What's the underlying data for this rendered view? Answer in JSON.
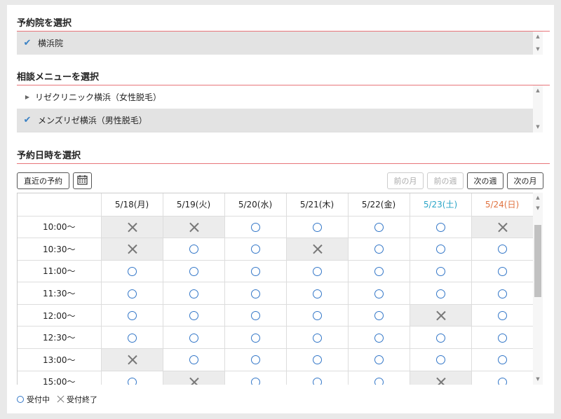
{
  "sections": {
    "clinic_title": "予約院を選択",
    "menu_title": "相談メニューを選択",
    "datetime_title": "予約日時を選択"
  },
  "clinic_list": {
    "items": [
      {
        "label": "横浜院",
        "selected": true
      }
    ]
  },
  "menu_list": {
    "items": [
      {
        "label": "リゼクリニック横浜（女性脱毛）",
        "selected": false
      },
      {
        "label": "メンズリゼ横浜（男性脱毛）",
        "selected": true
      }
    ]
  },
  "toolbar": {
    "recent_label": "直近の予約",
    "calendar_icon": "calendar-icon",
    "prev_month_label": "前の月",
    "prev_week_label": "前の週",
    "next_week_label": "次の週",
    "next_month_label": "次の月"
  },
  "schedule": {
    "days": [
      {
        "label": "5/18(月)",
        "kind": "weekday"
      },
      {
        "label": "5/19(火)",
        "kind": "weekday"
      },
      {
        "label": "5/20(水)",
        "kind": "weekday"
      },
      {
        "label": "5/21(木)",
        "kind": "weekday"
      },
      {
        "label": "5/22(金)",
        "kind": "weekday"
      },
      {
        "label": "5/23(土)",
        "kind": "saturday"
      },
      {
        "label": "5/24(日)",
        "kind": "sunday"
      }
    ],
    "rows": [
      {
        "time": "10:00〜",
        "slots": [
          "x",
          "x",
          "o",
          "o",
          "o",
          "o",
          "x"
        ]
      },
      {
        "time": "10:30〜",
        "slots": [
          "x",
          "o",
          "o",
          "x",
          "o",
          "o",
          "o"
        ]
      },
      {
        "time": "11:00〜",
        "slots": [
          "o",
          "o",
          "o",
          "o",
          "o",
          "o",
          "o"
        ]
      },
      {
        "time": "11:30〜",
        "slots": [
          "o",
          "o",
          "o",
          "o",
          "o",
          "o",
          "o"
        ]
      },
      {
        "time": "12:00〜",
        "slots": [
          "o",
          "o",
          "o",
          "o",
          "o",
          "x",
          "o"
        ]
      },
      {
        "time": "12:30〜",
        "slots": [
          "o",
          "o",
          "o",
          "o",
          "o",
          "o",
          "o"
        ]
      },
      {
        "time": "13:00〜",
        "slots": [
          "x",
          "o",
          "o",
          "o",
          "o",
          "o",
          "o"
        ]
      },
      {
        "time": "15:00〜",
        "slots": [
          "o",
          "x",
          "o",
          "o",
          "o",
          "x",
          "o"
        ]
      }
    ]
  },
  "legend": {
    "available_label": "受付中",
    "closed_label": "受付終了"
  },
  "colors": {
    "accent_rule": "#e8757a",
    "check": "#3b82c4",
    "circle": "#3377c8",
    "saturday": "#2aa5c7",
    "sunday": "#e0723f"
  }
}
